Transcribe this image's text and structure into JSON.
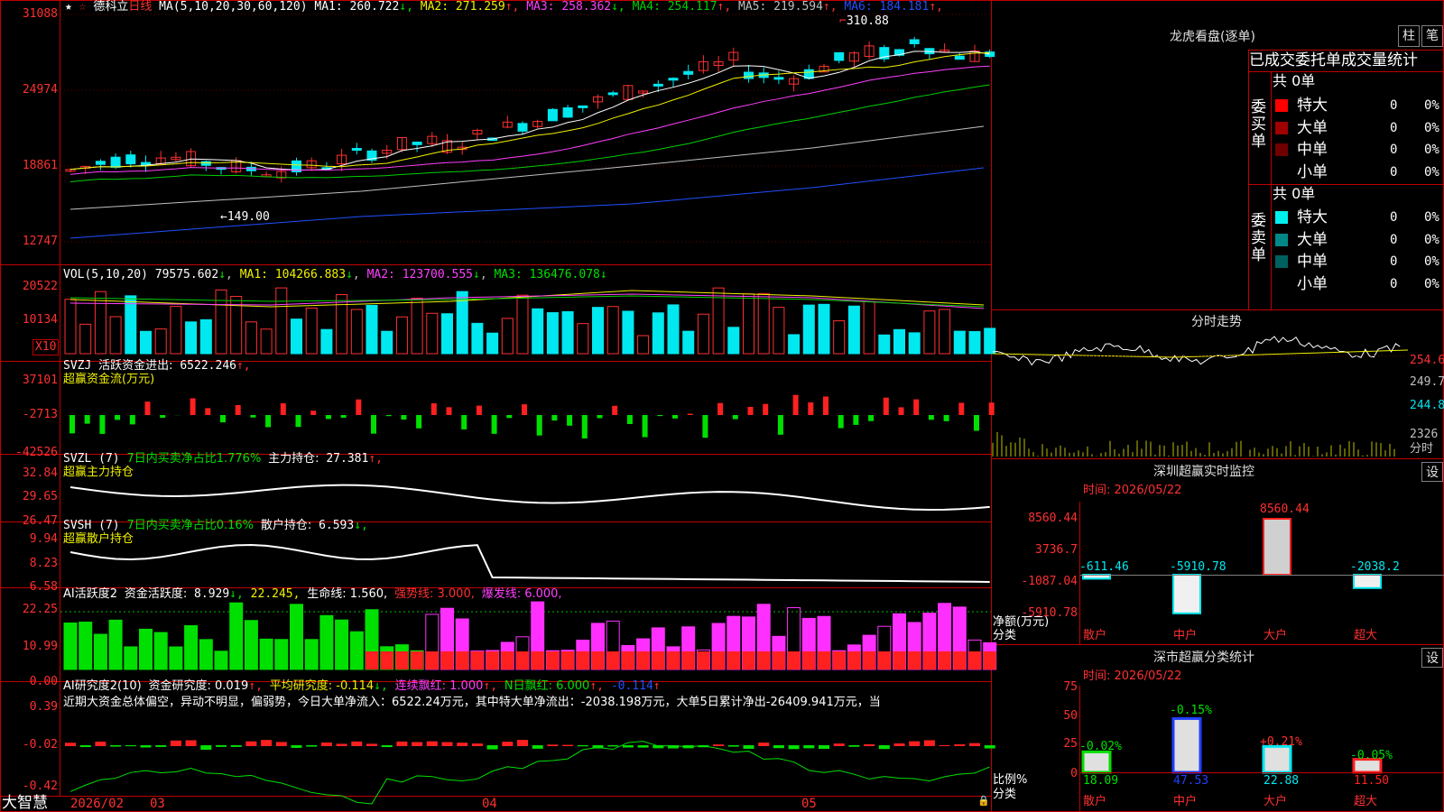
{
  "stock": {
    "name": "德科立",
    "period": "日线",
    "ma_params": "MA(5,10,20,30,60,120)",
    "ma": [
      {
        "label": "MA1:",
        "value": "260.722",
        "dir": "↓"
      },
      {
        "label": "MA2:",
        "value": "271.259",
        "dir": "↑"
      },
      {
        "label": "MA3:",
        "value": "258.362",
        "dir": "↓"
      },
      {
        "label": "MA4:",
        "value": "254.117",
        "dir": "↑"
      },
      {
        "label": "MA5:",
        "value": "219.594",
        "dir": "↑"
      },
      {
        "label": "MA6:",
        "value": "184.181",
        "dir": "↑"
      }
    ],
    "y_ticks": [
      "31088",
      "24974",
      "18861",
      "12747"
    ],
    "high_label": "310.88",
    "low_label": "149.00"
  },
  "colors": {
    "up": "#ff3030",
    "down": "#00e8f0",
    "grid": "#c00000",
    "ma1": "#ffffff",
    "ma2": "#f0f000",
    "ma3": "#ff40ff",
    "ma4": "#00d000",
    "ma5": "#c0c0c0",
    "ma6": "#2050ff"
  },
  "vol": {
    "params": "VOL(5,10,20)",
    "value": "79575.602",
    "dir": "↓",
    "ma1": "MA1: 104266.883",
    "ma1_dir": "↓",
    "ma2": "MA2: 123700.555",
    "ma2_dir": "↓",
    "ma3": "MA3: 136476.078",
    "ma3_dir": "↓",
    "y_ticks": [
      "20522",
      "10134"
    ],
    "unit": "X10"
  },
  "svzj": {
    "label": "SVZJ",
    "name": "活跃资金进出:",
    "value": "6522.246",
    "dir": "↑,",
    "subtitle": "超赢资金流(万元)",
    "y_ticks": [
      "37101",
      "-2713",
      "-42526"
    ]
  },
  "svzl": {
    "label": "SVZL (7)",
    "desc": "7日内买卖净占比1.776%",
    "pos_label": "主力持仓:",
    "pos_value": "27.381",
    "dir": "↑,",
    "subtitle": "超赢主力持仓",
    "y_ticks": [
      "32.84",
      "29.65",
      "26.47"
    ]
  },
  "svsh": {
    "label": "SVSH (7)",
    "desc": "7日内买卖净占比0.16%",
    "pos_label": "散户持仓:",
    "pos_value": "6.593",
    "dir": "↓,",
    "subtitle": "超赢散户持仓",
    "y_ticks": [
      "9.94",
      "8.23",
      "6.58"
    ]
  },
  "ai1": {
    "label": "AI活跃度2",
    "name": "资金活跃度:",
    "value": "8.929",
    "dir": "↓,",
    "v2": "22.245,",
    "life": "生命线: 1.560,",
    "strong": "强势线: 3.000,",
    "burst": "爆发线: 6.000,",
    "y_ticks": [
      "22.25",
      "10.99",
      "0.00"
    ]
  },
  "ai2": {
    "label": "AI研究度2(10)",
    "name": "资金研究度: 0.019",
    "dir": "↑,",
    "avg": "平均研究度: -0.114",
    "avg_dir": "↓,",
    "cont": "连续飘红: 1.000",
    "cont_dir": "↑,",
    "nred": "N日飘红: 6.000",
    "nred_dir": "↑,",
    "last": "-0.114",
    "last_dir": "↑",
    "comment": "近期大资金总体偏空，异动不明显，偏弱势，今日大单净流入：6522.24万元，其中特大单净流出：-2038.198万元，大单5日累计净出-26409.941万元，当",
    "y_ticks": [
      "0.39",
      "-0.02",
      "-0.42"
    ]
  },
  "xaxis": {
    "brand": "大智慧",
    "year": "2026/02",
    "months": [
      "03",
      "04",
      "05"
    ]
  },
  "lhb": {
    "title": "龙虎看盘(逐单)",
    "btn_col": "柱",
    "btn_pen": "笔",
    "subtitle": "已成交委托单成交量统计",
    "buy": {
      "side": "委买单",
      "total": "共 0单",
      "rows": [
        {
          "name": "特大",
          "count": "0",
          "pct": "0%",
          "color": "#ff0000"
        },
        {
          "name": "大单",
          "count": "0",
          "pct": "0%",
          "color": "#a00000"
        },
        {
          "name": "中单",
          "count": "0",
          "pct": "0%",
          "color": "#700000"
        },
        {
          "name": "小单",
          "count": "0",
          "pct": "0%",
          "color": "#000000"
        }
      ]
    },
    "sell": {
      "side": "委卖单",
      "total": "共 0单",
      "rows": [
        {
          "name": "特大",
          "count": "0",
          "pct": "0%",
          "color": "#00f0f0"
        },
        {
          "name": "大单",
          "count": "0",
          "pct": "0%",
          "color": "#008888"
        },
        {
          "name": "中单",
          "count": "0",
          "pct": "0%",
          "color": "#006060"
        },
        {
          "name": "小单",
          "count": "0",
          "pct": "0%",
          "color": "#000000"
        }
      ]
    }
  },
  "fenshi": {
    "title": "分时走势",
    "y_ticks": [
      "254.6",
      "249.7",
      "244.8",
      "2326"
    ],
    "unit": "分时"
  },
  "monitor": {
    "title": "深圳超赢实时监控",
    "btn": "设",
    "time": "时间: 2026/05/22",
    "y_ticks": [
      "8560.44",
      "3736.7",
      "-1087.04",
      "-5910.78"
    ],
    "ylabel": "净额(万元)",
    "xlabel": "分类",
    "cats": [
      "散户",
      "中户",
      "大户",
      "超大"
    ],
    "values": [
      "-611.46",
      "-5910.78",
      "8560.44",
      "-2038.2"
    ]
  },
  "classify": {
    "title": "深市超赢分类统计",
    "btn": "设",
    "time": "时间: 2026/05/22",
    "y_ticks": [
      "75",
      "50",
      "25",
      "0"
    ],
    "ylabel": "比例%",
    "xlabel": "分类",
    "cats": [
      "散户",
      "中户",
      "大户",
      "超大"
    ],
    "values": [
      "18.09",
      "47.53",
      "22.88",
      "11.50"
    ],
    "deltas": [
      "-0.02%",
      "-0.15%",
      "+0.21%",
      "-0.05%"
    ]
  },
  "chart_data": {
    "type": "candlestick",
    "x_range": [
      "2026/02",
      "2026/05/22"
    ],
    "y_range": [
      12747,
      31088
    ],
    "high": 310.88,
    "low": 149.0,
    "months": [
      "03",
      "04",
      "05"
    ]
  }
}
